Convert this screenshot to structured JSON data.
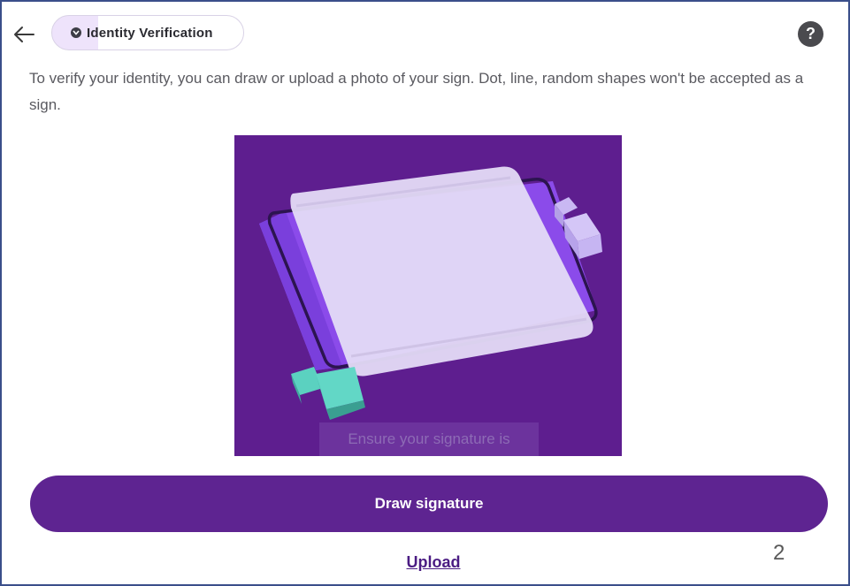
{
  "header": {
    "back_icon": "arrow-left-icon",
    "chip_icon": "chevron-down-circle-icon",
    "chip_label": "Identity Verification",
    "help_icon": "question-circle-icon",
    "help_glyph": "?"
  },
  "content": {
    "description": "To verify your identity, you can draw or upload a photo of your sign. Dot, line, random shapes won't be accepted as a sign.",
    "illustration_caption": "Ensure your signature is"
  },
  "actions": {
    "draw_label": "Draw signature",
    "upload_label": "Upload"
  },
  "page_number": "2",
  "colors": {
    "brand": "#5e2491",
    "illustration_bg": "#5e1e8f",
    "link": "#4b1c83"
  }
}
